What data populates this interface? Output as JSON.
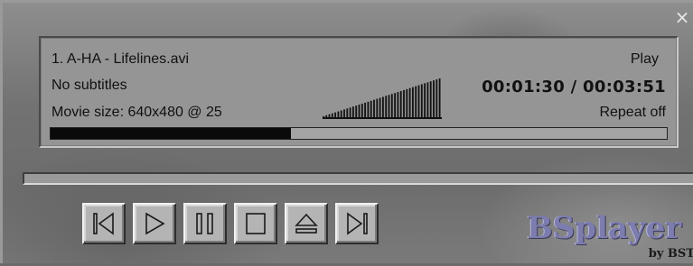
{
  "window": {
    "close_label": "×"
  },
  "display": {
    "file_name": "1. A-HA - Lifelines.avi",
    "subtitles": "No subtitles",
    "movie_size": "Movie size: 640x480 @ 25",
    "play_status": "Play",
    "time": "00:01:30 / 00:03:51",
    "repeat": "Repeat off",
    "volume_level": 1.0,
    "progress_fraction": 0.39
  },
  "controls": [
    {
      "name": "previous-button",
      "icon": "skip-back-icon"
    },
    {
      "name": "play-button",
      "icon": "play-icon"
    },
    {
      "name": "pause-button",
      "icon": "pause-icon"
    },
    {
      "name": "stop-button",
      "icon": "stop-icon"
    },
    {
      "name": "eject-button",
      "icon": "eject-icon"
    },
    {
      "name": "next-button",
      "icon": "skip-forward-icon"
    }
  ],
  "logo": {
    "word": "BSplayer",
    "by": "by BST"
  }
}
